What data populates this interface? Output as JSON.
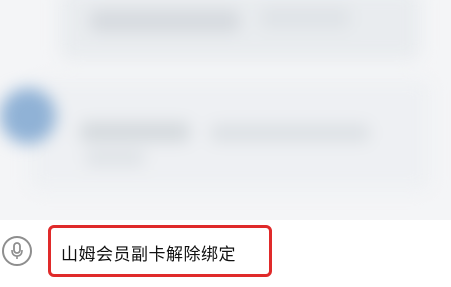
{
  "suggestion": {
    "text": "山姆会员副卡解除绑定",
    "highlight_color": "#e02a2a"
  },
  "input": {
    "voice_icon": "microphone-icon"
  }
}
